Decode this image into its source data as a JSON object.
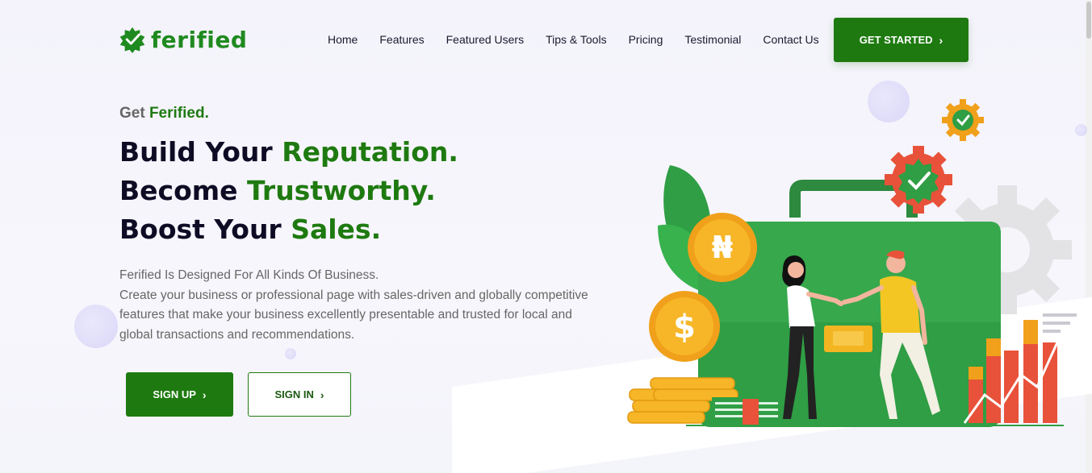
{
  "brand": {
    "name": "ferified",
    "color": "#1f8a1f"
  },
  "nav": {
    "items": [
      "Home",
      "Features",
      "Featured Users",
      "Tips & Tools",
      "Pricing",
      "Testimonial",
      "Contact Us"
    ]
  },
  "header": {
    "cta_label": "GET STARTED"
  },
  "hero": {
    "eyebrow_prefix": "Get ",
    "eyebrow_highlight": "Ferified.",
    "lines": [
      {
        "prefix": "Build Your ",
        "highlight": "Reputation."
      },
      {
        "prefix": "Become ",
        "highlight": "Trustworthy."
      },
      {
        "prefix": "Boost Your ",
        "highlight": "Sales."
      }
    ],
    "desc_line1": "Ferified Is Designed For All Kinds Of Business.",
    "desc_body": "Create your business or professional page with sales-driven and globally competitive features that make your business excellently presentable and trusted for local and global transactions and recommendations.",
    "signup_label": "SIGN UP",
    "signin_label": "SIGN IN"
  },
  "illustration": {
    "coin_symbols": [
      "₦",
      "$"
    ],
    "icons": [
      "verified-badge-icon",
      "gear-icon",
      "briefcase-icon",
      "handshake-people",
      "coin-stack-icon",
      "bar-chart-icon"
    ]
  },
  "colors": {
    "primary": "#1e7a10",
    "accent_orange": "#f0a01a",
    "accent_red": "#e8523a",
    "dark_text": "#0e0c24"
  }
}
